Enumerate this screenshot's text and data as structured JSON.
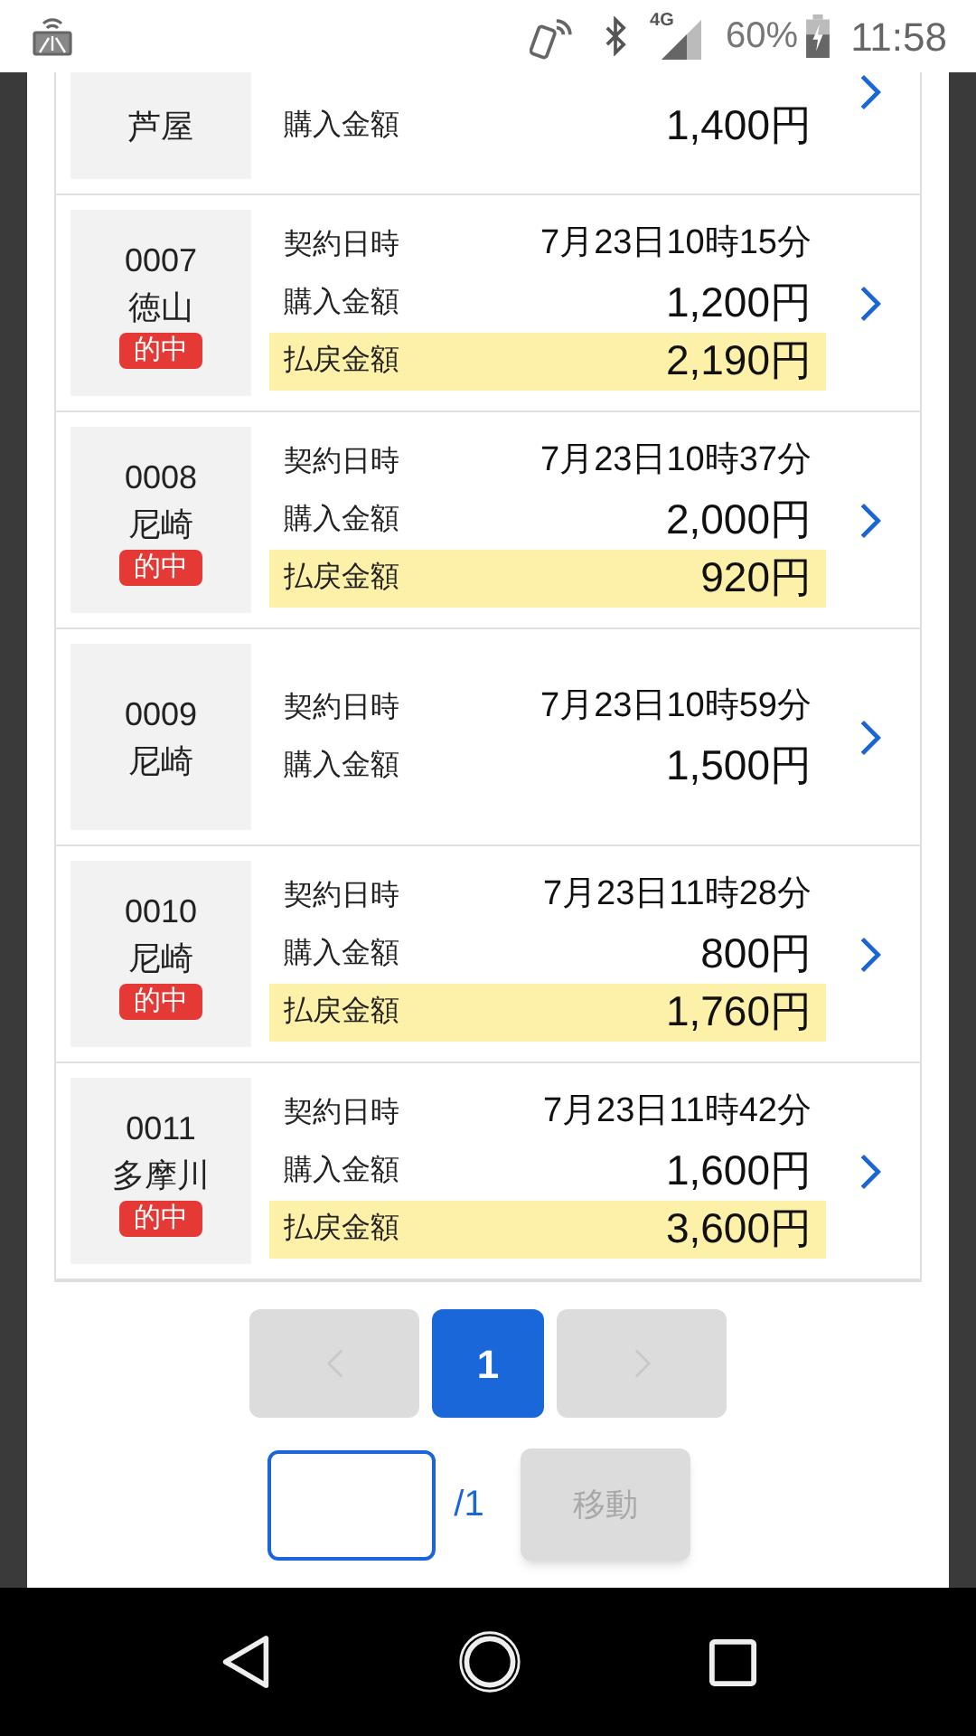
{
  "status_bar": {
    "network": "4G",
    "battery": "60%",
    "time": "11:58"
  },
  "cards": [
    {
      "venue": "芦屋",
      "rows": [
        {
          "label": "購入金額",
          "value": "1,400円",
          "highlighted": false
        }
      ]
    },
    {
      "number": "0007",
      "venue": "徳山",
      "badge": "的中",
      "rows": [
        {
          "label": "契約日時",
          "value": "7月23日10時15分",
          "highlighted": false
        },
        {
          "label": "購入金額",
          "value": "1,200円",
          "highlighted": false
        },
        {
          "label": "払戻金額",
          "value": "2,190円",
          "highlighted": true
        }
      ]
    },
    {
      "number": "0008",
      "venue": "尼崎",
      "badge": "的中",
      "rows": [
        {
          "label": "契約日時",
          "value": "7月23日10時37分",
          "highlighted": false
        },
        {
          "label": "購入金額",
          "value": "2,000円",
          "highlighted": false
        },
        {
          "label": "払戻金額",
          "value": "920円",
          "highlighted": true
        }
      ]
    },
    {
      "number": "0009",
      "venue": "尼崎",
      "rows": [
        {
          "label": "契約日時",
          "value": "7月23日10時59分",
          "highlighted": false
        },
        {
          "label": "購入金額",
          "value": "1,500円",
          "highlighted": false
        }
      ]
    },
    {
      "number": "0010",
      "venue": "尼崎",
      "badge": "的中",
      "rows": [
        {
          "label": "契約日時",
          "value": "7月23日11時28分",
          "highlighted": false
        },
        {
          "label": "購入金額",
          "value": "800円",
          "highlighted": false
        },
        {
          "label": "払戻金額",
          "value": "1,760円",
          "highlighted": true
        }
      ]
    },
    {
      "number": "0011",
      "venue": "多摩川",
      "badge": "的中",
      "rows": [
        {
          "label": "契約日時",
          "value": "7月23日11時42分",
          "highlighted": false
        },
        {
          "label": "購入金額",
          "value": "1,600円",
          "highlighted": false
        },
        {
          "label": "払戻金額",
          "value": "3,600円",
          "highlighted": true
        }
      ]
    }
  ],
  "pagination": {
    "pages": [
      {
        "label": "1",
        "selected": true
      }
    ],
    "total": "/1",
    "go_button": {
      "label": "移動",
      "disabled": true
    }
  }
}
